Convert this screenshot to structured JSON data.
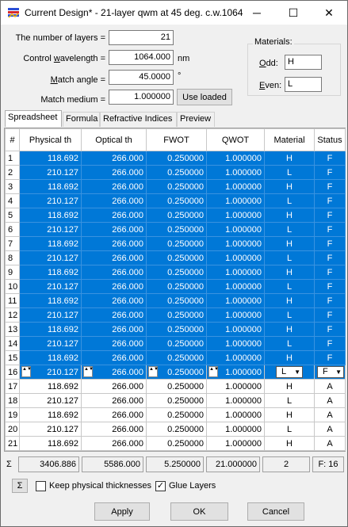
{
  "window": {
    "title": "Current Design* - 21-layer qwm at 45 deg. c.w.1064",
    "minimize_glyph": "─",
    "maximize_glyph": "☐",
    "close_glyph": "✕"
  },
  "form": {
    "layers_label": "The number of layers =",
    "layers_value": "21",
    "wavelength_label_pre": "Control ",
    "wavelength_label_u": "w",
    "wavelength_label_post": "avelength =",
    "wavelength_value": "1064.000",
    "wavelength_unit": "nm",
    "angle_label_u": "M",
    "angle_label_post": "atch angle =",
    "angle_value": "45.0000",
    "angle_unit": "°",
    "medium_label": "Match medium =",
    "medium_value": "1.000000",
    "use_loaded_label": "Use loaded"
  },
  "materials": {
    "title": "Materials:",
    "odd_label_u": "O",
    "odd_label_post": "dd:",
    "odd_value": "H",
    "even_label_u": "E",
    "even_label_post": "ven:",
    "even_value": "L"
  },
  "tabs": [
    "Spreadsheet",
    "Formula",
    "Refractive Indices",
    "Preview"
  ],
  "grid": {
    "headers": [
      "#",
      "Physical th",
      "Optical th",
      "FWOT",
      "QWOT",
      "Material",
      "Status"
    ],
    "rows": [
      [
        "1",
        "118.692",
        "266.000",
        "0.250000",
        "1.000000",
        "H",
        "F"
      ],
      [
        "2",
        "210.127",
        "266.000",
        "0.250000",
        "1.000000",
        "L",
        "F"
      ],
      [
        "3",
        "118.692",
        "266.000",
        "0.250000",
        "1.000000",
        "H",
        "F"
      ],
      [
        "4",
        "210.127",
        "266.000",
        "0.250000",
        "1.000000",
        "L",
        "F"
      ],
      [
        "5",
        "118.692",
        "266.000",
        "0.250000",
        "1.000000",
        "H",
        "F"
      ],
      [
        "6",
        "210.127",
        "266.000",
        "0.250000",
        "1.000000",
        "L",
        "F"
      ],
      [
        "7",
        "118.692",
        "266.000",
        "0.250000",
        "1.000000",
        "H",
        "F"
      ],
      [
        "8",
        "210.127",
        "266.000",
        "0.250000",
        "1.000000",
        "L",
        "F"
      ],
      [
        "9",
        "118.692",
        "266.000",
        "0.250000",
        "1.000000",
        "H",
        "F"
      ],
      [
        "10",
        "210.127",
        "266.000",
        "0.250000",
        "1.000000",
        "L",
        "F"
      ],
      [
        "11",
        "118.692",
        "266.000",
        "0.250000",
        "1.000000",
        "H",
        "F"
      ],
      [
        "12",
        "210.127",
        "266.000",
        "0.250000",
        "1.000000",
        "L",
        "F"
      ],
      [
        "13",
        "118.692",
        "266.000",
        "0.250000",
        "1.000000",
        "H",
        "F"
      ],
      [
        "14",
        "210.127",
        "266.000",
        "0.250000",
        "1.000000",
        "L",
        "F"
      ],
      [
        "15",
        "118.692",
        "266.000",
        "0.250000",
        "1.000000",
        "H",
        "F"
      ],
      [
        "16",
        "210.127",
        "266.000",
        "0.250000",
        "1.000000",
        "L",
        "F"
      ],
      [
        "17",
        "118.692",
        "266.000",
        "0.250000",
        "1.000000",
        "H",
        "A"
      ],
      [
        "18",
        "210.127",
        "266.000",
        "0.250000",
        "1.000000",
        "L",
        "A"
      ],
      [
        "19",
        "118.692",
        "266.000",
        "0.250000",
        "1.000000",
        "H",
        "A"
      ],
      [
        "20",
        "210.127",
        "266.000",
        "0.250000",
        "1.000000",
        "L",
        "A"
      ],
      [
        "21",
        "118.692",
        "266.000",
        "0.250000",
        "1.000000",
        "H",
        "A"
      ]
    ],
    "selected_rows": 15,
    "editing_row": 16
  },
  "sums": {
    "sigma": "Σ",
    "physical": "3406.886",
    "optical": "5586.000",
    "fwot": "5.250000",
    "qwot": "21.000000",
    "material": "2",
    "status": "F: 16"
  },
  "options": {
    "sigma_button": "Σ",
    "keep_physical_label": "Keep physical thicknesses",
    "keep_physical_checked": false,
    "glue_layers_label": "Glue Layers",
    "glue_layers_checked": true
  },
  "buttons": {
    "apply": "Apply",
    "ok": "OK",
    "cancel": "Cancel"
  },
  "colors": {
    "selection": "#0078d7"
  }
}
